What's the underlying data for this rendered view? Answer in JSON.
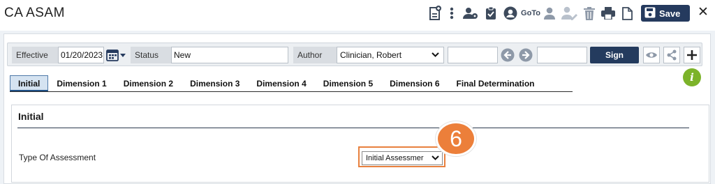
{
  "app": {
    "title": "CA ASAM"
  },
  "toolbar": {
    "goto_label": "GoTo",
    "save_label": "Save",
    "close_label": "✕"
  },
  "header": {
    "effective_label": "Effective",
    "effective_value": "01/20/2023",
    "status_label": "Status",
    "status_value": "New",
    "author_label": "Author",
    "author_value": "Clinician, Robert",
    "sign_label": "Sign"
  },
  "tabs": [
    {
      "label": "Initial",
      "active": true
    },
    {
      "label": "Dimension 1"
    },
    {
      "label": "Dimension 2"
    },
    {
      "label": "Dimension 3"
    },
    {
      "label": "Dimension 4"
    },
    {
      "label": "Dimension 5"
    },
    {
      "label": "Dimension 6"
    },
    {
      "label": "Final Determination"
    }
  ],
  "section": {
    "title": "Initial",
    "type_label": "Type Of Assessment",
    "type_value": "Initial Assessmer"
  },
  "callout": {
    "number": "6",
    "color": "#ec7f3a"
  },
  "info": {
    "glyph": "i",
    "color": "#7cb32a"
  }
}
